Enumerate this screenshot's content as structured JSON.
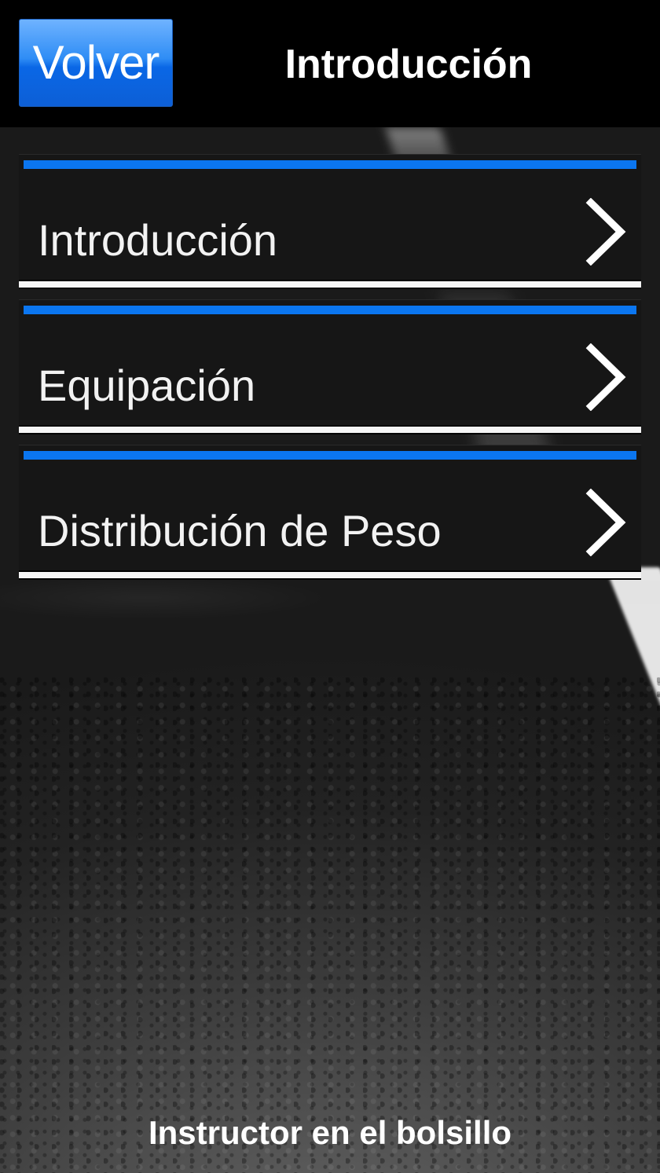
{
  "header": {
    "back_label": "Volver",
    "title": "Introducción"
  },
  "menu": {
    "items": [
      {
        "label": "Introducción",
        "icon": "chevron-right-icon"
      },
      {
        "label": "Equipación",
        "icon": "chevron-right-icon"
      },
      {
        "label": "Distribución de Peso",
        "icon": "chevron-right-icon"
      }
    ]
  },
  "footer": {
    "text": "Instructor en el bolsillo"
  },
  "colors": {
    "accent": "#0b76f0",
    "button_blue": "#0a67e6",
    "panel": "#161616",
    "text": "#ffffff"
  }
}
